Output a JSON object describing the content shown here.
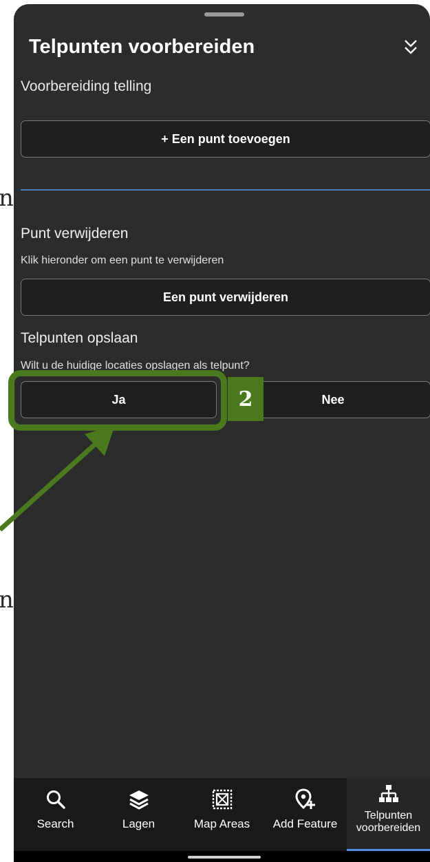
{
  "page_edge_text": {
    "top": "n",
    "bottom": "n"
  },
  "header": {
    "title": "Telpunten voorbereiden",
    "subtitle": "Voorbereiding telling"
  },
  "add_point": {
    "button_label": "+ Een punt toevoegen"
  },
  "delete_section": {
    "title": "Punt verwijderen",
    "description": "Klik hieronder om een punt te verwijderen",
    "button_label": "Een punt verwijderen"
  },
  "save_section": {
    "title": "Telpunten opslaan",
    "description": "Wilt u de huidige locaties opslagen als telpunt?",
    "yes_label": "Ja",
    "no_label": "Nee"
  },
  "annotation": {
    "step_number": "2",
    "color": "#4b7a1e"
  },
  "bottom_nav": {
    "items": [
      {
        "label": "Search",
        "icon": "search-icon"
      },
      {
        "label": "Lagen",
        "icon": "layers-icon"
      },
      {
        "label": "Map Areas",
        "icon": "map-areas-icon"
      },
      {
        "label": "Add Feature",
        "icon": "add-location-icon"
      },
      {
        "label": "Telpunten voorbereiden",
        "icon": "hierarchy-icon",
        "active": true
      }
    ]
  },
  "colors": {
    "panel": "#2c2c2c",
    "accent": "#4d8fe0",
    "divider": "#4d7fc1"
  }
}
